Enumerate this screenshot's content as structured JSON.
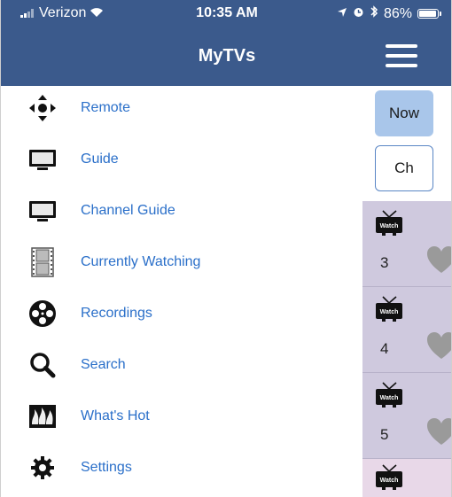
{
  "status_bar": {
    "carrier": "Verizon",
    "time": "10:35 AM",
    "battery_text": "86%",
    "battery_level": 0.86
  },
  "header": {
    "title": "MyTVs",
    "menu_icon": "hamburger-icon"
  },
  "menu": {
    "items": [
      {
        "label": "Remote",
        "icon": "remote-dpad-icon"
      },
      {
        "label": "Guide",
        "icon": "tv-monitor-icon"
      },
      {
        "label": "Channel Guide",
        "icon": "tv-monitor-icon"
      },
      {
        "label": "Currently Watching",
        "icon": "film-strip-icon"
      },
      {
        "label": "Recordings",
        "icon": "film-reel-icon"
      },
      {
        "label": "Search",
        "icon": "magnifier-icon"
      },
      {
        "label": "What's Hot",
        "icon": "fire-icon"
      },
      {
        "label": "Settings",
        "icon": "gear-icon"
      }
    ]
  },
  "panel": {
    "now_label": "Now",
    "ch_label": "Ch",
    "channels": [
      {
        "badge": "Watch",
        "number": "3"
      },
      {
        "badge": "Watch",
        "number": "4"
      },
      {
        "badge": "Watch",
        "number": "5"
      },
      {
        "badge": "Watch",
        "number": ""
      }
    ]
  },
  "colors": {
    "header_bg": "#3b5a8c",
    "link_blue": "#2a6fc9",
    "now_button_bg": "#a9c6ea",
    "channel_bg": "#cfc9de"
  }
}
